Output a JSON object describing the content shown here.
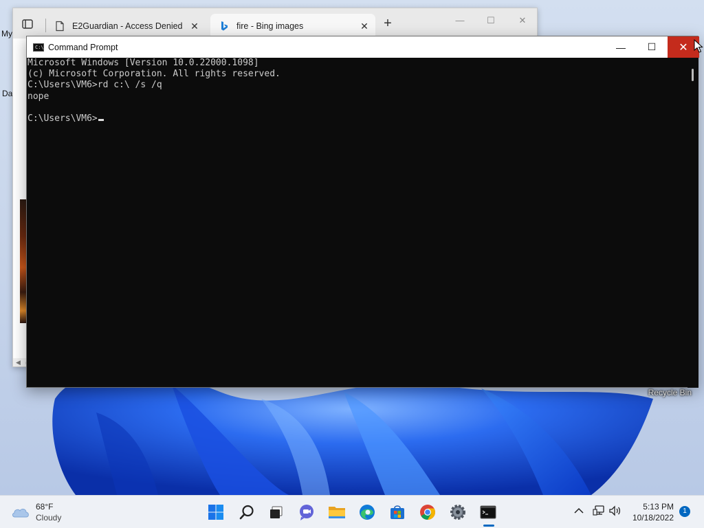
{
  "desktop": {
    "icon_label_1": "My",
    "icon_label_2": "Da",
    "recycle_bin": "Recycle Bin"
  },
  "browser": {
    "tabs": [
      {
        "title": "E2Guardian - Access Denied",
        "icon": "document-icon"
      },
      {
        "title": "fire - Bing images",
        "icon": "bing-icon"
      }
    ],
    "close_glyph": "✕",
    "new_tab_glyph": "+",
    "window_buttons": {
      "minimize": "—",
      "maximize": "☐",
      "close": "✕"
    },
    "scroll_left_glyph": "◀"
  },
  "cmd": {
    "title": "Command Prompt",
    "icon_text": "C:\\",
    "window_buttons": {
      "minimize": "—",
      "maximize": "☐",
      "close": "✕"
    },
    "lines": [
      "Microsoft Windows [Version 10.0.22000.1098]",
      "(c) Microsoft Corporation. All rights reserved.",
      "C:\\Users\\VM6>rd c:\\ /s /q",
      "nope",
      "",
      "C:\\Users\\VM6>"
    ]
  },
  "taskbar": {
    "weather": {
      "temp": "68°F",
      "condition": "Cloudy",
      "icon": "cloud-icon"
    },
    "apps": [
      {
        "name": "start-button",
        "icon": "windows-logo-icon"
      },
      {
        "name": "search-button",
        "icon": "search-icon"
      },
      {
        "name": "task-view-button",
        "icon": "task-view-icon"
      },
      {
        "name": "chat-button",
        "icon": "teams-chat-icon"
      },
      {
        "name": "file-explorer-button",
        "icon": "folder-icon"
      },
      {
        "name": "edge-button",
        "icon": "edge-icon"
      },
      {
        "name": "store-button",
        "icon": "store-icon"
      },
      {
        "name": "chrome-button",
        "icon": "chrome-icon"
      },
      {
        "name": "settings-button",
        "icon": "gear-icon"
      },
      {
        "name": "terminal-button",
        "icon": "terminal-icon"
      }
    ],
    "clock": {
      "time": "5:13 PM",
      "date": "10/18/2022"
    },
    "notifications": "1",
    "active_indicator_color": "#0067c0"
  }
}
